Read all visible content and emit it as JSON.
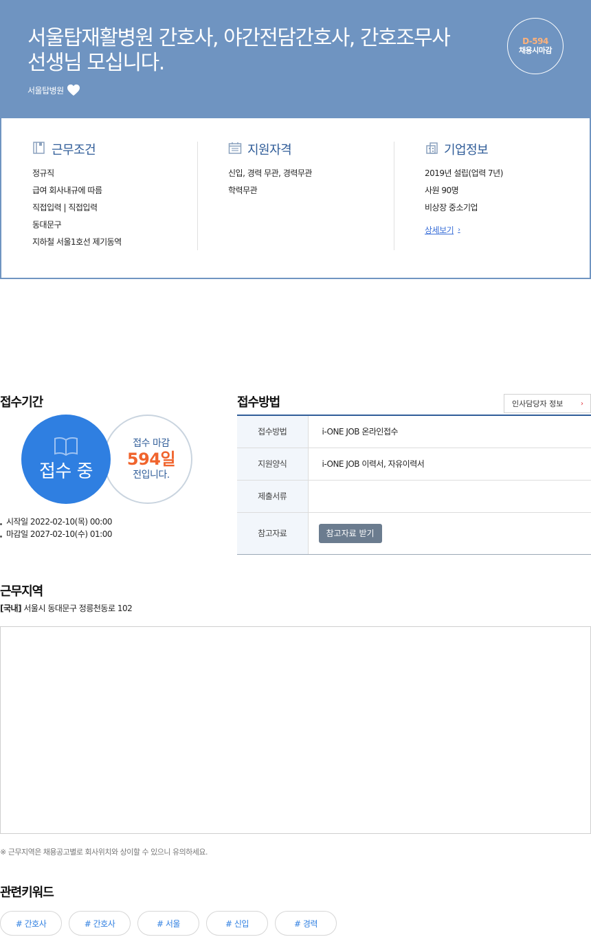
{
  "header": {
    "title": "서울탑재활병원 간호사, 야간전담간호사, 간호조무사선생님 모십니다.",
    "company": "서울탑병원",
    "dday": {
      "count": "D-594",
      "label": "채용시마감"
    }
  },
  "summary": {
    "conditions": {
      "title": "근무조건",
      "items": [
        "정규직",
        "급여 회사내규에 따름",
        "직접입력 | 직접입력",
        "동대문구",
        "지하철 서울1호선 제기동역"
      ]
    },
    "qualifications": {
      "title": "지원자격",
      "items": [
        "신입, 경력 무관, 경력무관",
        "학력무관"
      ]
    },
    "company_info": {
      "title": "기업정보",
      "items": [
        "2019년 설립(업력 7년)",
        "사원 90명",
        "비상장 중소기업"
      ],
      "detail_link": "상세보기"
    }
  },
  "reception_period": {
    "title": "접수기간",
    "status": "접수 중",
    "close_top": "접수 마감",
    "close_days": "594일",
    "close_bottom": "전입니다.",
    "start": "시작일 2022-02-10(목) 00:00",
    "end": "마감일 2027-02-10(수) 01:00"
  },
  "application": {
    "title": "접수방법",
    "hr_button": "인사담당자 정보",
    "rows": [
      {
        "label": "접수방법",
        "value": "i-ONE JOB 온라인접수"
      },
      {
        "label": "지원양식",
        "value": "i-ONE JOB 이력서, 자유이력서"
      },
      {
        "label": "제출서류",
        "value": ""
      },
      {
        "label": "참고자료",
        "value": ""
      }
    ],
    "reference_button": "참고자료 받기"
  },
  "location": {
    "title": "근무지역",
    "region": "[국내]",
    "address": "서울시 동대문구 정릉천동로 102",
    "notice": "※ 근무지역은 채용공고별로 회사위치와 상이할 수 있으니 유의하세요."
  },
  "keywords": {
    "title": "관련키워드",
    "items": [
      "# 간호사",
      "# 간호사",
      "# 서울",
      "# 신입",
      "# 경력"
    ]
  },
  "colors": {
    "header_bg": "#6f94c1",
    "accent_blue": "#2f7fe1",
    "title_blue": "#2f5c98",
    "dday_orange": "#ffb27a",
    "days_orange": "#f0642d"
  }
}
